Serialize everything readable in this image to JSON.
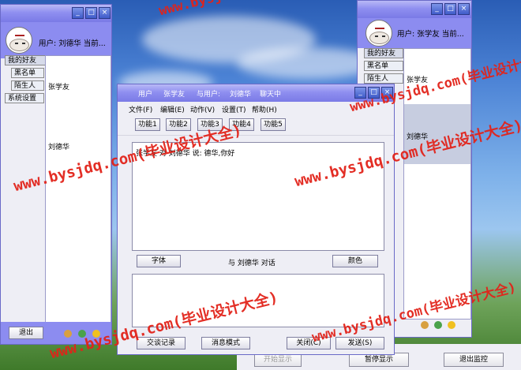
{
  "left_window": {
    "user_label": "用户: 刘德华 当前...",
    "tabs": [
      "我的好友",
      "黑名单",
      "陌生人",
      "系统设置"
    ],
    "friends": [
      "张学友",
      "刘德华"
    ],
    "logout_label": "退出"
  },
  "right_window": {
    "user_label": "用户: 张学友 当前...",
    "tabs": [
      "我的好友",
      "黑名单",
      "陌生人"
    ],
    "friends": [
      "张学友",
      "刘德华"
    ]
  },
  "chat_window": {
    "title_bits": [
      "用户",
      "张学友",
      "与用户:",
      "刘德华",
      "聊天中"
    ],
    "menu": [
      "文件(F)",
      "编辑(E)",
      "动作(V)",
      "设置(T)",
      "帮助(H)"
    ],
    "functions": [
      "功能1",
      "功能2",
      "功能3",
      "功能4",
      "功能5"
    ],
    "message": "张学友 对 刘德华 说: 德华,你好",
    "font_button": "字体",
    "dialog_label": "与 刘德华 对话",
    "color_button": "颜色",
    "history_button": "交谈记录",
    "msgmode_button": "消息模式",
    "close_button": "关闭(C)",
    "send_button": "发送(S)"
  },
  "monitor": {
    "start_label": "开始显示",
    "pause_label": "暂停显示",
    "exit_label": "退出监控"
  },
  "watermarks": [
    "www.bysjdq.com(毕业设计大全)",
    "www.bysjdq.com(毕业设计大全)",
    "www.bysjdq.com(毕业设计大全)",
    "www.bysjdq.com(毕业设计大",
    "www.bysjdq.com(毕业设计大全)",
    "www.bysjdq.com(毕业设计大全)"
  ]
}
